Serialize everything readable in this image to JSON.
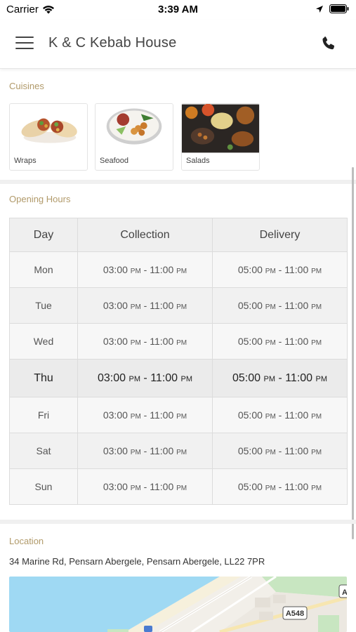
{
  "status_bar": {
    "carrier": "Carrier",
    "time": "3:39 AM"
  },
  "header": {
    "title": "K & C Kebab House"
  },
  "cuisines": {
    "label": "Cuisines",
    "items": [
      {
        "name": "Wraps"
      },
      {
        "name": "Seafood"
      },
      {
        "name": "Salads"
      }
    ]
  },
  "opening_hours": {
    "label": "Opening Hours",
    "columns": [
      "Day",
      "Collection",
      "Delivery"
    ],
    "am_pm": "PM",
    "rows": [
      {
        "day": "Mon",
        "collection_start": "03:00",
        "collection_end": "11:00",
        "delivery_start": "05:00",
        "delivery_end": "11:00"
      },
      {
        "day": "Tue",
        "collection_start": "03:00",
        "collection_end": "11:00",
        "delivery_start": "05:00",
        "delivery_end": "11:00"
      },
      {
        "day": "Wed",
        "collection_start": "03:00",
        "collection_end": "11:00",
        "delivery_start": "05:00",
        "delivery_end": "11:00"
      },
      {
        "day": "Thu",
        "collection_start": "03:00",
        "collection_end": "11:00",
        "delivery_start": "05:00",
        "delivery_end": "11:00"
      },
      {
        "day": "Fri",
        "collection_start": "03:00",
        "collection_end": "11:00",
        "delivery_start": "05:00",
        "delivery_end": "11:00"
      },
      {
        "day": "Sat",
        "collection_start": "03:00",
        "collection_end": "11:00",
        "delivery_start": "05:00",
        "delivery_end": "11:00"
      },
      {
        "day": "Sun",
        "collection_start": "03:00",
        "collection_end": "11:00",
        "delivery_start": "05:00",
        "delivery_end": "11:00"
      }
    ],
    "highlighted_day": "Thu"
  },
  "location": {
    "label": "Location",
    "address": "34 Marine Rd, Pensarn Abergele, Pensarn Abergele, LL22 7PR",
    "map": {
      "road_label": "A548",
      "edge_label": "A"
    }
  },
  "colors": {
    "section_label": "#b19a6a",
    "map_sea": "#9fd9f3",
    "map_land": "#f2efe9",
    "map_green": "#c8e6c1"
  },
  "icons": {
    "menu": "hamburger-menu-icon",
    "phone": "phone-icon",
    "wifi": "wifi-icon",
    "location_arrow": "location-arrow-icon",
    "battery": "battery-icon"
  }
}
